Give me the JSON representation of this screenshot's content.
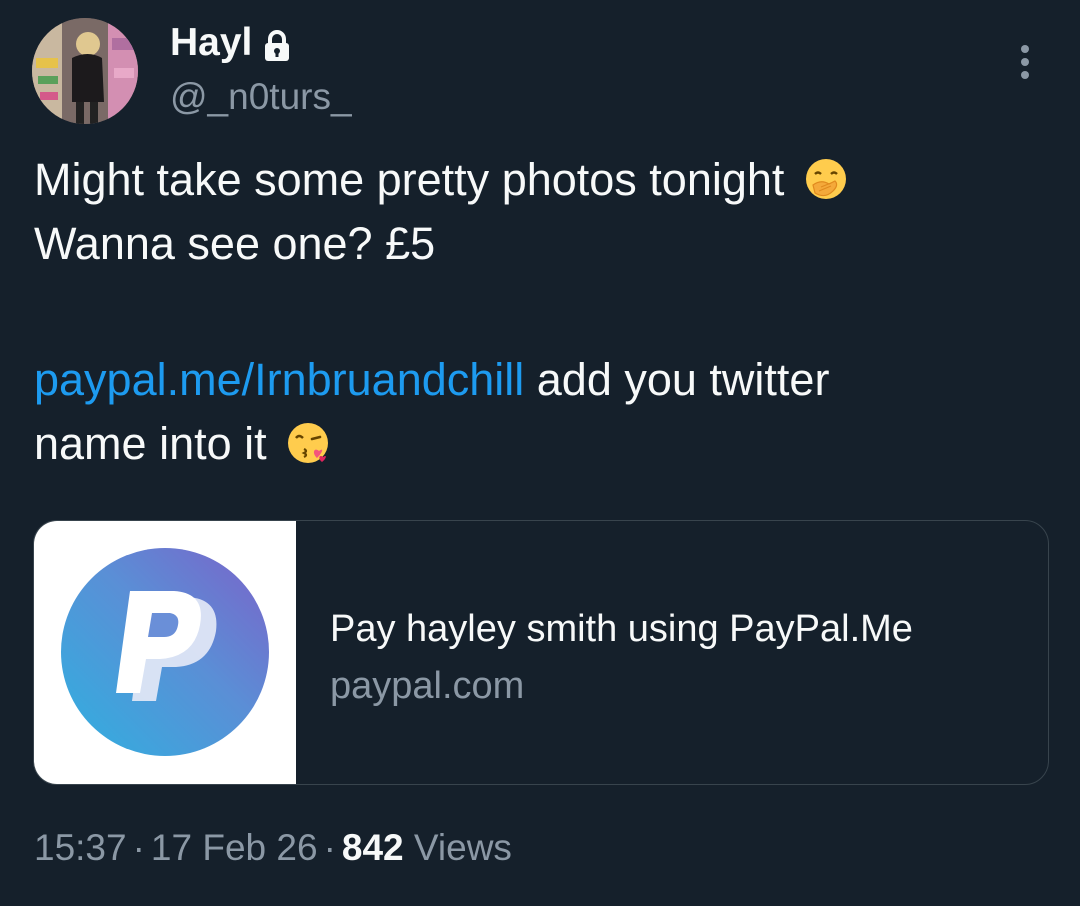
{
  "user": {
    "display_name": "Hayl",
    "handle": "@_n0turs_",
    "protected_icon": "lock-icon",
    "avatar_icon": "profile-photo"
  },
  "tweet": {
    "line1": "Might take some pretty photos tonight",
    "line1_emoji": "face-with-hand-over-mouth-emoji",
    "line2": "Wanna see one? £5",
    "link_text": "paypal.me/Irnbruandchill",
    "line3_rest": " add you twitter",
    "line4": "name into it",
    "line4_emoji": "face-blowing-a-kiss-emoji"
  },
  "card": {
    "title": "Pay hayley smith using PayPal.Me",
    "domain": "paypal.com",
    "thumbnail_icon": "paypal-logo"
  },
  "meta": {
    "time": "15:37",
    "date": "17 Feb 26",
    "separator": "·",
    "views_count": "842",
    "views_label": " Views"
  },
  "colors": {
    "background": "#15202b",
    "text": "#f7f9f9",
    "secondary": "#8b98a5",
    "link": "#1d9bf0",
    "border": "#38444d"
  }
}
